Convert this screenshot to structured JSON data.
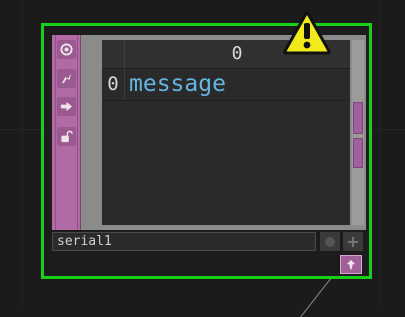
{
  "operator": {
    "name": "serial1",
    "status": "warning",
    "columns": [
      "0"
    ],
    "rows": [
      {
        "index": "0",
        "value": "message"
      }
    ],
    "sidebar_flags": [
      "viewer-flag-icon",
      "cook-flag-icon",
      "bypass-arrow-icon",
      "lock-flag-icon"
    ]
  },
  "colors": {
    "selection_border": "#18d018",
    "dat_accent": "#b16aa6",
    "cell_text": "#64b6e0",
    "warning_fill": "#f2ea1a"
  }
}
